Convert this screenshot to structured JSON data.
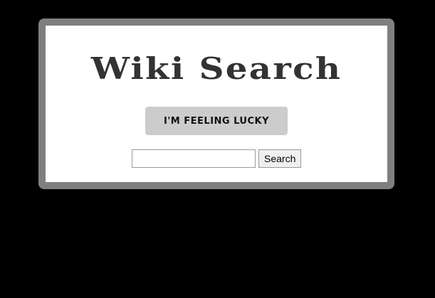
{
  "app": {
    "title": "Wiki Search"
  },
  "actions": {
    "lucky_label": "I'm Feeling Lucky"
  },
  "search": {
    "value": "",
    "placeholder": "",
    "button_label": "Search"
  },
  "colors": {
    "page_background": "#000000",
    "frame_border": "#7f7f7f",
    "card_background": "#ffffff",
    "title_text": "#333333",
    "lucky_button_background": "#cccccc"
  }
}
